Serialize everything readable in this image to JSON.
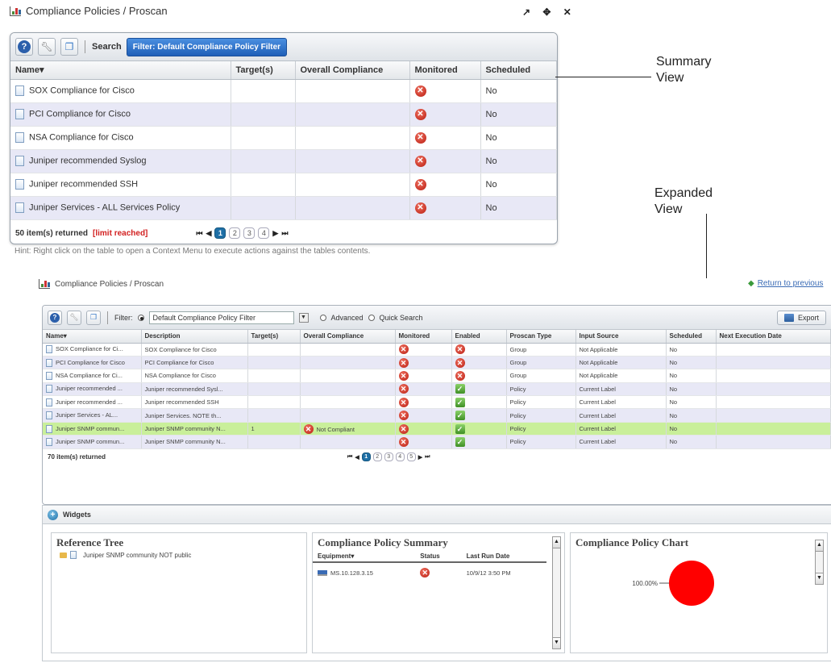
{
  "summary": {
    "title": "Compliance Policies / Proscan",
    "window_controls": "↗ ✥ ✕",
    "toolbar": {
      "search_label": "Search",
      "filter_label": "Filter: Default Compliance Policy Filter"
    },
    "columns": [
      "Name▾",
      "Target(s)",
      "Overall Compliance",
      "Monitored",
      "Scheduled"
    ],
    "rows": [
      {
        "name": "SOX Compliance for Cisco",
        "scheduled": "No"
      },
      {
        "name": "PCI Compliance for Cisco",
        "scheduled": "No"
      },
      {
        "name": "NSA Compliance for Cisco",
        "scheduled": "No"
      },
      {
        "name": "Juniper recommended Syslog",
        "scheduled": "No"
      },
      {
        "name": "Juniper recommended SSH",
        "scheduled": "No"
      },
      {
        "name": "Juniper Services - ALL Services Policy",
        "scheduled": "No"
      }
    ],
    "footer": {
      "count": "50 item(s) returned",
      "limit": "[limit reached]",
      "pages": [
        "1",
        "2",
        "3",
        "4"
      ]
    }
  },
  "hint": "Hint: Right click on the table to open a Context Menu to execute actions against the tables contents.",
  "annotations": {
    "summary_line1": "Summary",
    "summary_line2": "View",
    "expanded_line1": "Expanded",
    "expanded_line2": "View"
  },
  "expanded": {
    "title": "Compliance Policies / Proscan",
    "return_link": "Return to previous",
    "toolbar": {
      "filter_label": "Filter:",
      "filter_value": "Default Compliance Policy Filter",
      "advanced": "Advanced",
      "quick_search": "Quick Search",
      "export": "Export"
    },
    "columns": [
      "Name▾",
      "Description",
      "Target(s)",
      "Overall Compliance",
      "Monitored",
      "Enabled",
      "Proscan Type",
      "Input Source",
      "Scheduled",
      "Next Execution Date"
    ],
    "rows": [
      {
        "name": "SOX Compliance for Ci...",
        "description": "SOX Compliance for Cisco",
        "targets": "",
        "compliance": "",
        "enabled": "x",
        "type": "Group",
        "input": "Not Applicable",
        "scheduled": "No"
      },
      {
        "name": "PCI Compliance for Cisco",
        "description": "PCI Compliance for Cisco",
        "targets": "",
        "compliance": "",
        "enabled": "x",
        "type": "Group",
        "input": "Not Applicable",
        "scheduled": "No"
      },
      {
        "name": "NSA Compliance for Ci...",
        "description": "NSA Compliance for Cisco",
        "targets": "",
        "compliance": "",
        "enabled": "x",
        "type": "Group",
        "input": "Not Applicable",
        "scheduled": "No"
      },
      {
        "name": "Juniper recommended ...",
        "description": "Juniper recommended Sysl...",
        "targets": "",
        "compliance": "",
        "enabled": "check",
        "type": "Policy",
        "input": "Current Label",
        "scheduled": "No"
      },
      {
        "name": "Juniper recommended ...",
        "description": "Juniper recommended SSH",
        "targets": "",
        "compliance": "",
        "enabled": "check",
        "type": "Policy",
        "input": "Current Label",
        "scheduled": "No"
      },
      {
        "name": "Juniper Services - AL...",
        "description": "Juniper Services. NOTE th...",
        "targets": "",
        "compliance": "",
        "enabled": "check",
        "type": "Policy",
        "input": "Current Label",
        "scheduled": "No"
      },
      {
        "name": "Juniper SNMP commun...",
        "description": "Juniper SNMP community N...",
        "targets": "1",
        "compliance": "Not Compliant",
        "enabled": "check",
        "type": "Policy",
        "input": "Current Label",
        "scheduled": "No",
        "highlight": true
      },
      {
        "name": "Juniper SNMP commun...",
        "description": "Juniper SNMP community N...",
        "targets": "",
        "compliance": "",
        "enabled": "check",
        "type": "Policy",
        "input": "Current Label",
        "scheduled": "No"
      }
    ],
    "footer": {
      "count": "70 item(s) returned",
      "pages": [
        "1",
        "2",
        "3",
        "4",
        "5"
      ]
    },
    "widgets": {
      "bar_label": "Widgets",
      "reference_tree": {
        "title": "Reference Tree",
        "item": "Juniper SNMP community NOT public"
      },
      "policy_summary": {
        "title": "Compliance Policy Summary",
        "columns": [
          "Equipment▾",
          "Status",
          "Last Run Date"
        ],
        "row": {
          "equipment": "MS.10.128.3.15",
          "date": "10/9/12 3:50 PM"
        }
      },
      "policy_chart": {
        "title": "Compliance Policy Chart",
        "label": "100.00%"
      }
    }
  },
  "colors": {
    "accent": "#1e6fa6",
    "highlight_row": "#c9ef9a",
    "alt_row": "#e8e8f6",
    "error": "#d21f1f"
  },
  "chart_data": {
    "type": "pie",
    "title": "Compliance Policy Chart",
    "categories": [
      "Not Compliant"
    ],
    "values": [
      100.0
    ],
    "labels": [
      "100.00%"
    ],
    "colors": [
      "#ff0000"
    ]
  }
}
